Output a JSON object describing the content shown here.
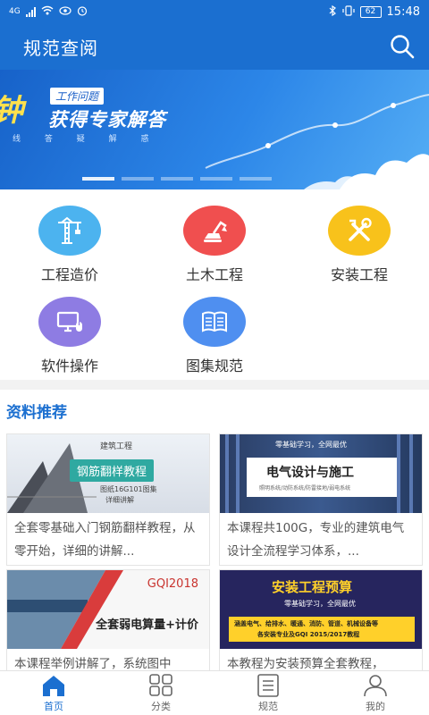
{
  "status_bar": {
    "network": "4G",
    "battery": "62",
    "time": "15:48"
  },
  "header": {
    "title": "规范查阅",
    "search_icon": "search-icon"
  },
  "banner": {
    "big_char": "钟",
    "tag": "工作问题",
    "headline": "获得专家解答",
    "sub": "线 答 疑 解 惑",
    "slide_count": 5,
    "active_slide": 1
  },
  "categories": [
    {
      "label": "工程造价",
      "icon": "tower-crane-icon",
      "color": "#4cb3ef"
    },
    {
      "label": "土木工程",
      "icon": "excavator-icon",
      "color": "#f04f4f"
    },
    {
      "label": "安装工程",
      "icon": "tools-icon",
      "color": "#f8c21b"
    },
    {
      "label": "软件操作",
      "icon": "computer-icon",
      "color": "#8e7ce3"
    },
    {
      "label": "图集规范",
      "icon": "open-book-icon",
      "color": "#4f8ff0"
    }
  ],
  "recommend": {
    "title": "资料推荐",
    "items": [
      {
        "desc": "全套零基础入门钢筋翻样教程，从零开始，详细的讲解...",
        "thumb": {
          "badge": "建筑工程",
          "title": "钢筋翻样教程",
          "sub": "图纸16G101图集",
          "sub2": "详细讲解"
        }
      },
      {
        "desc": "本课程共100G，专业的建筑电气设计全流程学习体系，...",
        "thumb": {
          "top": "零基础学习，全网最优",
          "title": "电气设计与施工",
          "sub": "照明系统/动防系统/防雷接地/弱电系统"
        }
      },
      {
        "desc": "本课程举例讲解了，系统图中",
        "thumb": {
          "code": "GQI2018",
          "title": "全套弱电算量+计价"
        }
      },
      {
        "desc": "本教程为安装预算全套教程，",
        "thumb": {
          "title": "安装工程预算",
          "sub": "零基础学习，全网最优",
          "note": "涵盖电气、给排水、暖通、消防、管道、机械设备等",
          "note2": "各安装专业及GQI 2015/2017教程"
        }
      }
    ]
  },
  "bottom_nav": [
    {
      "label": "首页",
      "icon": "home-icon",
      "active": true
    },
    {
      "label": "分类",
      "icon": "grid-icon",
      "active": false
    },
    {
      "label": "规范",
      "icon": "document-list-icon",
      "active": false
    },
    {
      "label": "我的",
      "icon": "person-icon",
      "active": false
    }
  ],
  "colors": {
    "primary": "#1b6fd0",
    "banner_yellow": "#ffe14d"
  }
}
